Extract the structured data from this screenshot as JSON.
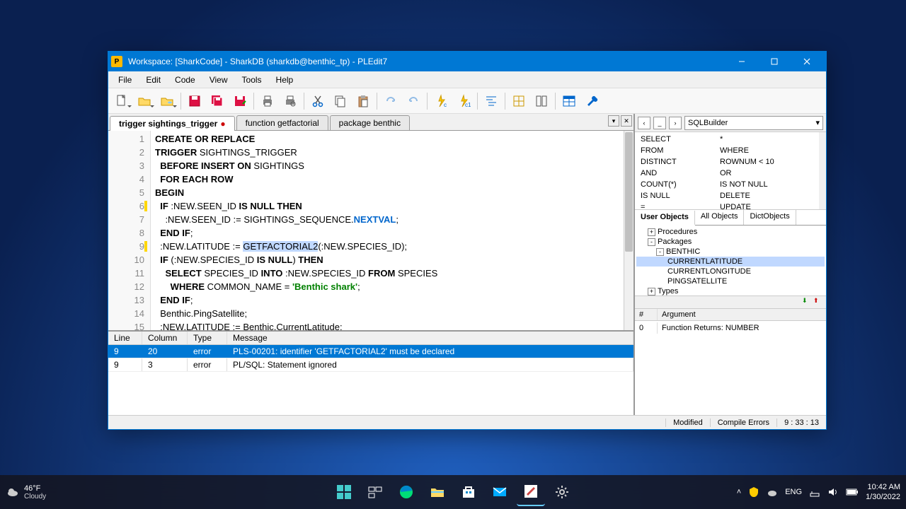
{
  "titlebar": "Workspace: [SharkCode] - SharkDB (sharkdb@benthic_tp) - PLEdit7",
  "menu": [
    "File",
    "Edit",
    "Code",
    "View",
    "Tools",
    "Help"
  ],
  "tabs": [
    {
      "label": "trigger sightings_trigger",
      "dirty": true,
      "active": true
    },
    {
      "label": "function getfactorial",
      "dirty": false,
      "active": false
    },
    {
      "label": "package benthic",
      "dirty": false,
      "active": false
    }
  ],
  "code": {
    "lines": [
      {
        "n": 1,
        "marked": false,
        "tokens": [
          [
            "kw",
            "CREATE OR REPLACE"
          ]
        ]
      },
      {
        "n": 2,
        "marked": false,
        "tokens": [
          [
            "kw",
            "TRIGGER"
          ],
          [
            "",
            " SIGHTINGS_TRIGGER"
          ]
        ]
      },
      {
        "n": 3,
        "marked": false,
        "tokens": [
          [
            "",
            "  "
          ],
          [
            "kw",
            "BEFORE INSERT ON"
          ],
          [
            "",
            " SIGHTINGS"
          ]
        ]
      },
      {
        "n": 4,
        "marked": false,
        "tokens": [
          [
            "",
            "  "
          ],
          [
            "kw",
            "FOR EACH ROW"
          ]
        ]
      },
      {
        "n": 5,
        "marked": false,
        "tokens": [
          [
            "kw",
            "BEGIN"
          ]
        ]
      },
      {
        "n": 6,
        "marked": true,
        "tokens": [
          [
            "",
            "  "
          ],
          [
            "kw",
            "IF"
          ],
          [
            "",
            " :NEW.SEEN_ID "
          ],
          [
            "kw",
            "IS NULL THEN"
          ]
        ]
      },
      {
        "n": 7,
        "marked": false,
        "tokens": [
          [
            "",
            "    :NEW.SEEN_ID := SIGHTINGS_SEQUENCE."
          ],
          [
            "fn",
            "NEXTVAL"
          ],
          [
            "",
            ";"
          ]
        ]
      },
      {
        "n": 8,
        "marked": false,
        "tokens": [
          [
            "",
            "  "
          ],
          [
            "kw",
            "END IF"
          ],
          [
            "",
            ";"
          ]
        ]
      },
      {
        "n": 9,
        "marked": true,
        "tokens": [
          [
            "",
            "  :NEW.LATITUDE := "
          ],
          [
            "hl",
            "GETFACTORIAL2"
          ],
          [
            "",
            "(:NEW.SPECIES_ID);"
          ]
        ]
      },
      {
        "n": 10,
        "marked": false,
        "tokens": [
          [
            "",
            "  "
          ],
          [
            "kw",
            "IF"
          ],
          [
            "",
            " (:NEW.SPECIES_ID "
          ],
          [
            "kw",
            "IS NULL"
          ],
          [
            "",
            ") "
          ],
          [
            "kw",
            "THEN"
          ]
        ]
      },
      {
        "n": 11,
        "marked": false,
        "tokens": [
          [
            "",
            "    "
          ],
          [
            "kw",
            "SELECT"
          ],
          [
            "",
            " SPECIES_ID "
          ],
          [
            "kw",
            "INTO"
          ],
          [
            "",
            " :NEW.SPECIES_ID "
          ],
          [
            "kw",
            "FROM"
          ],
          [
            "",
            " SPECIES"
          ]
        ]
      },
      {
        "n": 12,
        "marked": false,
        "tokens": [
          [
            "",
            "      "
          ],
          [
            "kw",
            "WHERE"
          ],
          [
            "",
            " COMMON_NAME = "
          ],
          [
            "str",
            "'Benthic shark'"
          ],
          [
            "",
            ";"
          ]
        ]
      },
      {
        "n": 13,
        "marked": false,
        "tokens": [
          [
            "",
            "  "
          ],
          [
            "kw",
            "END IF"
          ],
          [
            "",
            ";"
          ]
        ]
      },
      {
        "n": 14,
        "marked": false,
        "tokens": [
          [
            "",
            "  Benthic.PingSatellite;"
          ]
        ]
      },
      {
        "n": 15,
        "marked": false,
        "tokens": [
          [
            "",
            "  :NEW.LATITUDE := Benthic.CurrentLatitude;"
          ]
        ]
      }
    ]
  },
  "errors": {
    "headers": [
      "Line",
      "Column",
      "Type",
      "Message"
    ],
    "rows": [
      {
        "line": "9",
        "col": "20",
        "type": "error",
        "msg": "PLS-00201: identifier 'GETFACTORIAL2' must be declared",
        "sel": true
      },
      {
        "line": "9",
        "col": "3",
        "type": "error",
        "msg": "PL/SQL: Statement ignored",
        "sel": false
      }
    ]
  },
  "sqlbuilder": {
    "label": "SQLBuilder",
    "grid": [
      [
        "SELECT",
        "*"
      ],
      [
        "FROM",
        "WHERE"
      ],
      [
        "DISTINCT",
        "ROWNUM < 10"
      ],
      [
        "AND",
        "OR"
      ],
      [
        "COUNT(*)",
        "IS NOT NULL"
      ],
      [
        "IS NULL",
        "DELETE"
      ],
      [
        "=",
        "UPDATE"
      ]
    ]
  },
  "objtabs": [
    "User Objects",
    "All Objects",
    "DictObjects"
  ],
  "tree": [
    {
      "label": "Procedures",
      "level": 0,
      "exp": "+"
    },
    {
      "label": "Packages",
      "level": 0,
      "exp": "-"
    },
    {
      "label": "BENTHIC",
      "level": 1,
      "exp": "-"
    },
    {
      "label": "CURRENTLATITUDE",
      "level": 2,
      "sel": true
    },
    {
      "label": "CURRENTLONGITUDE",
      "level": 2
    },
    {
      "label": "PINGSATELLITE",
      "level": 2
    },
    {
      "label": "Types",
      "level": 0,
      "exp": "+"
    }
  ],
  "args": {
    "headers": [
      "#",
      "Argument"
    ],
    "rows": [
      [
        "0",
        "Function Returns: NUMBER"
      ]
    ]
  },
  "status": {
    "modified": "Modified",
    "compile": "Compile Errors",
    "pos": "9 : 33 : 13"
  },
  "taskbar": {
    "weather": {
      "temp": "46°F",
      "cond": "Cloudy"
    },
    "lang": "ENG",
    "time": "10:42 AM",
    "date": "1/30/2022"
  }
}
